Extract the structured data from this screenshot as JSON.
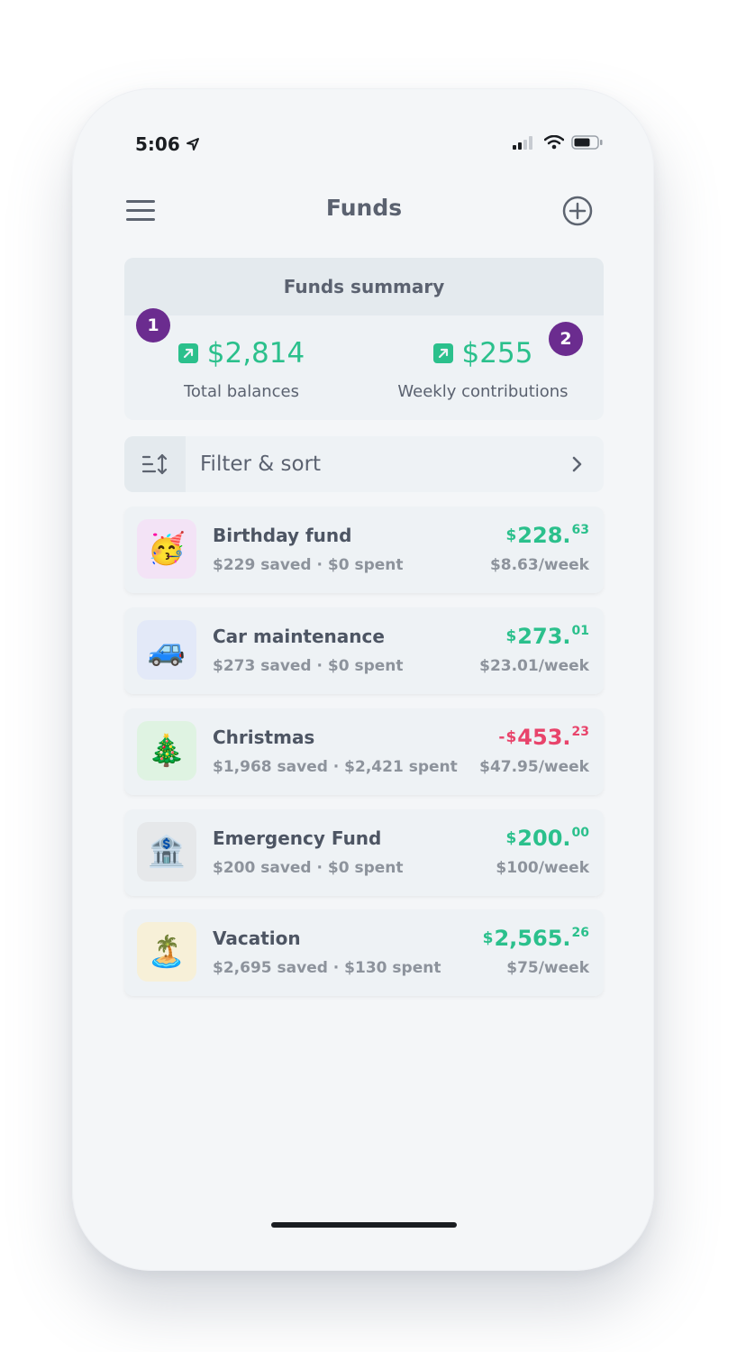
{
  "status": {
    "time": "5:06"
  },
  "header": {
    "title": "Funds"
  },
  "summary": {
    "title": "Funds summary",
    "total": {
      "value": "$2,814",
      "label": "Total balances"
    },
    "weekly": {
      "value": "$255",
      "label": "Weekly contributions"
    },
    "badges": [
      "1",
      "2"
    ]
  },
  "filter": {
    "label": "Filter & sort"
  },
  "funds": [
    {
      "name": "Birthday fund",
      "sub": "$229 saved · $0 spent",
      "sign": "",
      "currency": "$",
      "whole": "228.",
      "cents": "63",
      "rate": "$8.63/week",
      "emoji": "🥳",
      "bg": "#f3e3f6"
    },
    {
      "name": "Car maintenance",
      "sub": "$273 saved · $0 spent",
      "sign": "",
      "currency": "$",
      "whole": "273.",
      "cents": "01",
      "rate": "$23.01/week",
      "emoji": "🚙",
      "bg": "#e3e9f8"
    },
    {
      "name": "Christmas",
      "sub": "$1,968 saved · $2,421 spent",
      "sign": "-",
      "currency": "$",
      "whole": "453.",
      "cents": "23",
      "rate": "$47.95/week",
      "emoji": "🎄",
      "bg": "#dff3e2"
    },
    {
      "name": "Emergency Fund",
      "sub": "$200 saved · $0 spent",
      "sign": "",
      "currency": "$",
      "whole": "200.",
      "cents": "00",
      "rate": "$100/week",
      "emoji": "🏦",
      "bg": "#e6e8ea"
    },
    {
      "name": "Vacation",
      "sub": "$2,695 saved · $130 spent",
      "sign": "",
      "currency": "$",
      "whole": "2,565.",
      "cents": "26",
      "rate": "$75/week",
      "emoji": "🏝️",
      "bg": "#f7f0d8"
    }
  ],
  "colors": {
    "positive": "#2bc08c",
    "negative": "#e8446b",
    "badge": "#6b2c8f"
  }
}
